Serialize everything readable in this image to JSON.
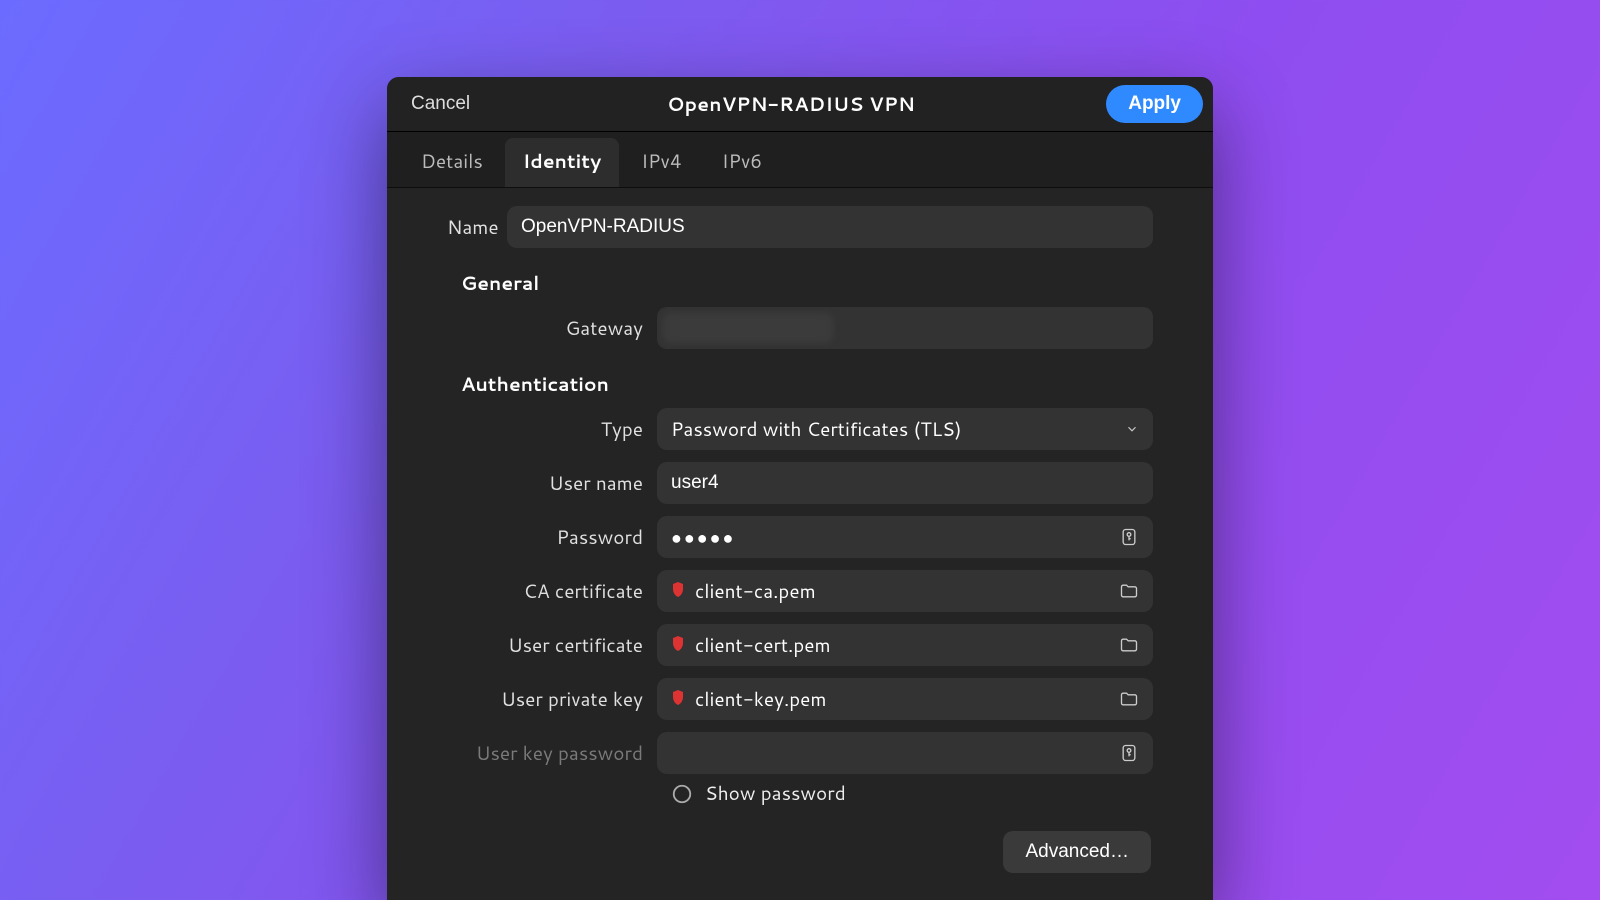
{
  "header": {
    "cancel": "Cancel",
    "title": "OpenVPN-RADIUS VPN",
    "apply": "Apply"
  },
  "tabs": {
    "details": "Details",
    "identity": "Identity",
    "ipv4": "IPv4",
    "ipv6": "IPv6",
    "active": "identity"
  },
  "form": {
    "name_label": "Name",
    "name_value": "OpenVPN-RADIUS",
    "section_general": "General",
    "gateway_label": "Gateway",
    "gateway_value": "",
    "section_auth": "Authentication",
    "type_label": "Type",
    "type_value": "Password with Certificates (TLS)",
    "username_label": "User name",
    "username_value": "user4",
    "password_label": "Password",
    "password_masked": "●●●●●",
    "ca_label": "CA certificate",
    "ca_value": "client-ca.pem",
    "usercert_label": "User certificate",
    "usercert_value": "client-cert.pem",
    "userkey_label": "User private key",
    "userkey_value": "client-key.pem",
    "userkeypw_label": "User key password",
    "userkeypw_value": "",
    "show_pw_label": "Show password",
    "show_pw_checked": false,
    "advanced": "Advanced…"
  }
}
